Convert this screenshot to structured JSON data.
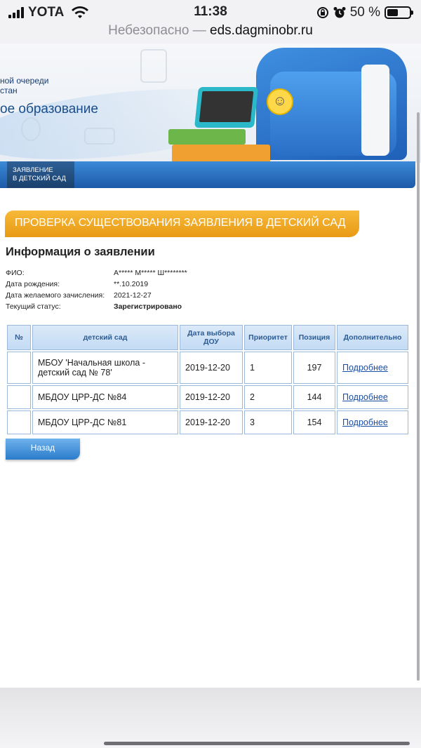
{
  "status_bar": {
    "carrier": "YOTA",
    "time": "11:38",
    "battery_percent": "50 %",
    "battery_level": 0.5,
    "signal_icon": "signal-bars-icon",
    "wifi_icon": "wifi-icon",
    "rotation_lock_icon": "rotation-lock-icon",
    "alarm_icon": "alarm-clock-icon"
  },
  "url_bar": {
    "insecure_label": "Небезопасно —",
    "domain": "eds.dagminobr.ru"
  },
  "banner": {
    "line1": "ной очереди",
    "line2": "стан",
    "title": "ое образование"
  },
  "nav": {
    "item_line1": "Заявление",
    "item_line2": "в детский сад"
  },
  "section_title": "ПРОВЕРКА СУЩЕСТВОВАНИЯ ЗАЯВЛЕНИЯ В ДЕТСКИЙ САД",
  "info": {
    "heading": "Информация о заявлении",
    "fio_label": "ФИО:",
    "fio_value": "А***** М***** Ш********",
    "birth_label": "Дата рождения:",
    "birth_value": "**.10.2019",
    "enroll_label": "Дата желаемого зачисления:",
    "enroll_value": "2021-12-27",
    "status_label": "Текущий статус:",
    "status_value": "Зарегистрировано"
  },
  "table": {
    "headers": [
      "№",
      "детский сад",
      "Дата выбора ДОУ",
      "Приоритет",
      "Позиция",
      "Дополнительно"
    ],
    "rows": [
      {
        "num": "",
        "kindergarten": "МБОУ 'Начальная школа - детский сад № 78'",
        "date": "2019-12-20",
        "priority": "1",
        "position": "197",
        "more": "Подробнее"
      },
      {
        "num": "",
        "kindergarten": "МБДОУ ЦРР-ДС №84",
        "date": "2019-12-20",
        "priority": "2",
        "position": "144",
        "more": "Подробнее"
      },
      {
        "num": "",
        "kindergarten": "МБДОУ ЦРР-ДС №81",
        "date": "2019-12-20",
        "priority": "3",
        "position": "154",
        "more": "Подробнее"
      }
    ]
  },
  "back_button": "Назад",
  "colors": {
    "nav_blue": "#1c5aa8",
    "section_orange": "#e89a14",
    "table_header_text": "#2d5c93",
    "link": "#1a4ea0"
  }
}
